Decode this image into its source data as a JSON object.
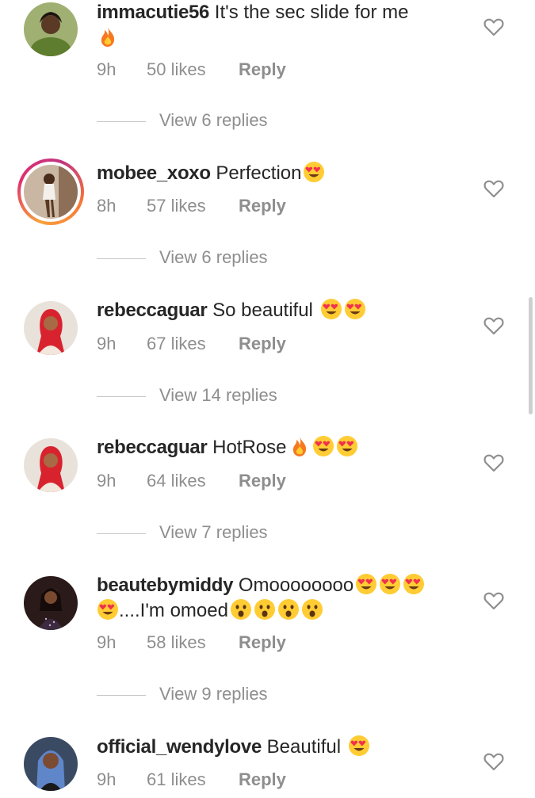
{
  "comments": [
    {
      "username": "immacutie56",
      "text": "It's the  sec slide for me",
      "emojis": [
        "fire"
      ],
      "time": "9h",
      "likes": "50 likes",
      "reply_label": "Reply",
      "view_replies": "View 6 replies"
    },
    {
      "username": "mobee_xoxo",
      "text": "Perfection",
      "emojis": [
        "heart-eyes"
      ],
      "time": "8h",
      "likes": "57 likes",
      "reply_label": "Reply",
      "view_replies": "View 6 replies"
    },
    {
      "username": "rebeccaguar",
      "text": "So beautiful",
      "emojis": [
        "heart-eyes",
        "heart-eyes"
      ],
      "time": "9h",
      "likes": "67 likes",
      "reply_label": "Reply",
      "view_replies": "View 14 replies"
    },
    {
      "username": "rebeccaguar",
      "text": "HotRose",
      "emojis": [
        "fire",
        "heart-eyes",
        "heart-eyes"
      ],
      "time": "9h",
      "likes": "64 likes",
      "reply_label": "Reply",
      "view_replies": "View 7 replies"
    },
    {
      "username": "beautebymiddy",
      "text": "Omoooooooo",
      "emojis": [
        "heart-eyes",
        "heart-eyes",
        "heart-eyes",
        "heart-eyes"
      ],
      "text2": "....I'm omoed",
      "emojis2": [
        "astonished",
        "astonished",
        "astonished",
        "astonished"
      ],
      "time": "9h",
      "likes": "58 likes",
      "reply_label": "Reply",
      "view_replies": "View 9 replies"
    },
    {
      "username": "official_wendylove",
      "text": "Beautiful",
      "emojis": [
        "heart-eyes"
      ],
      "time": "9h",
      "likes": "61 likes",
      "reply_label": "Reply"
    }
  ],
  "icons": {
    "like": "heart-outline-icon"
  },
  "colors": {
    "text": "#262626",
    "muted": "#8e8e8e",
    "emoji_face": "#ffcc33",
    "heart_red": "#f0314e"
  }
}
